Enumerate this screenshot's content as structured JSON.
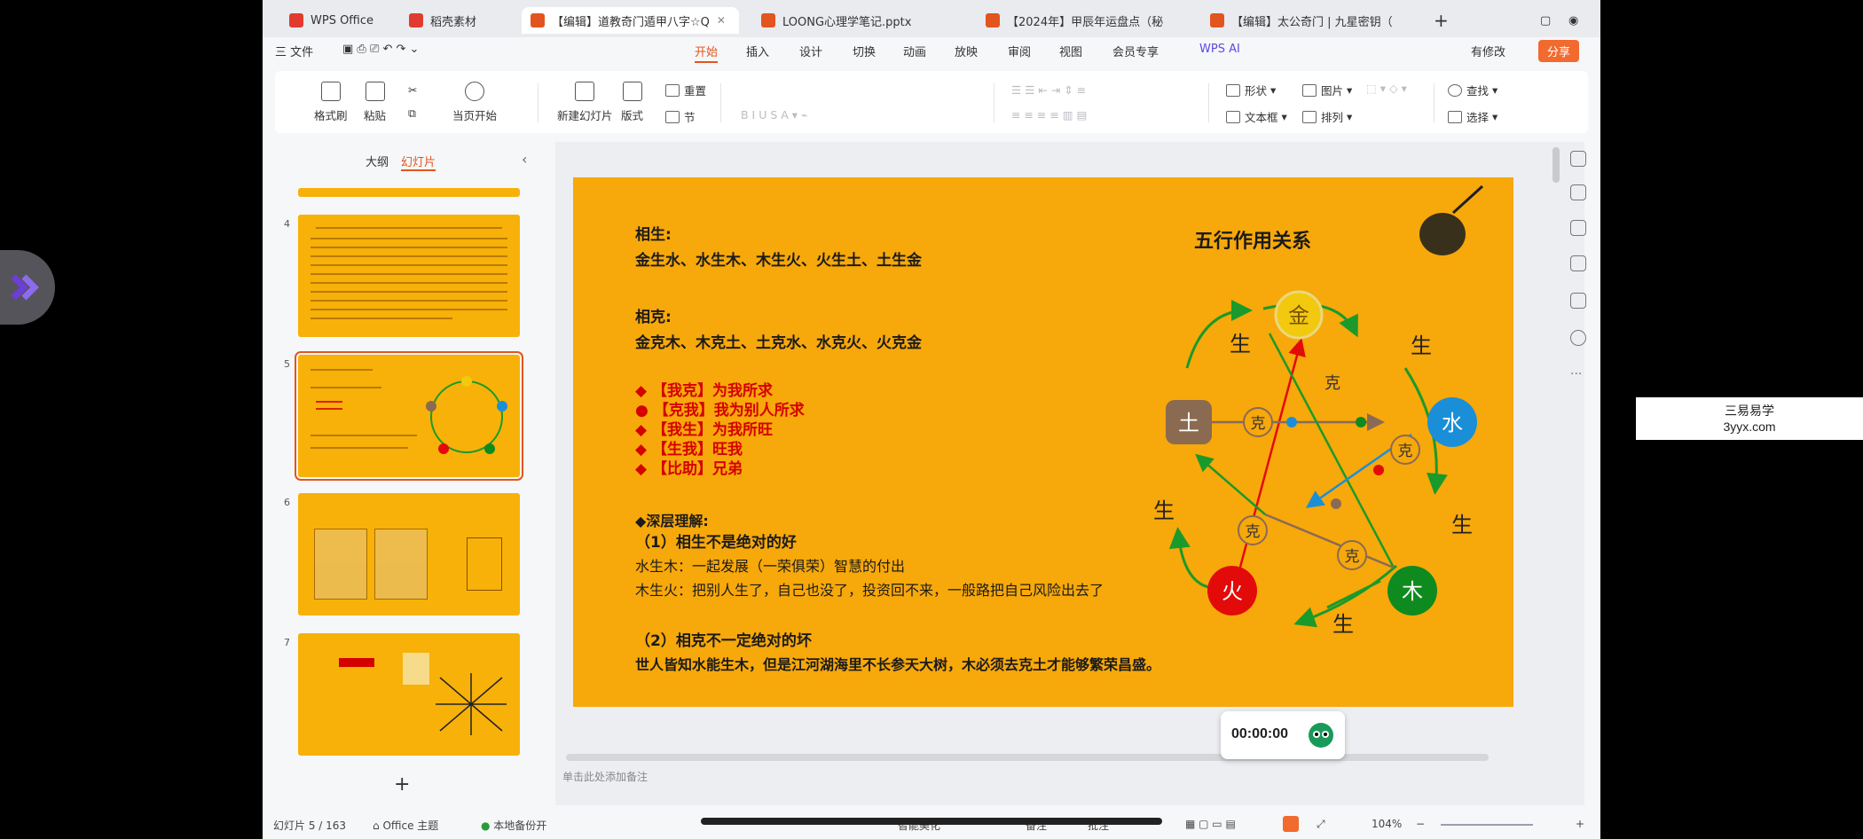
{
  "overlay": {
    "watermark_line1": "三易易学",
    "watermark_line2": "3yyx.com"
  },
  "tabs": [
    {
      "label": "WPS Office",
      "color": "#e03b2e"
    },
    {
      "label": "稻壳素材",
      "color": "#e03b2e"
    },
    {
      "label": "【编辑】道教奇门遁甲八字☆Q",
      "color": "#e2551e",
      "active": true
    },
    {
      "label": "LOONG心理学笔记.pptx",
      "color": "#e2551e"
    },
    {
      "label": "【2024年】甲辰年运盘点（秘",
      "color": "#e2551e"
    },
    {
      "label": "【编辑】太公奇门 | 九星密钥（",
      "color": "#e2551e"
    }
  ],
  "menu": {
    "file": "三 文件",
    "items": [
      "开始",
      "插入",
      "设计",
      "切换",
      "动画",
      "放映",
      "审阅",
      "视图",
      "会员专享"
    ],
    "ai": "WPS AI",
    "modify": "有修改",
    "share": "分享"
  },
  "ribbon": {
    "format_painter": "格式刷",
    "paste": "粘贴",
    "from_current": "当页开始",
    "new_slide": "新建幻灯片",
    "layout": "版式",
    "reset": "重置",
    "section": "节",
    "shape": "形状",
    "picture": "图片",
    "find": "查找",
    "textbox": "文本框",
    "arrange": "排列",
    "select": "选择"
  },
  "panel": {
    "tab_outline": "大纲",
    "tab_slides": "幻灯片",
    "slide_numbers": [
      "4",
      "5",
      "6",
      "7"
    ],
    "add": "+"
  },
  "slide": {
    "title": "五行作用关系",
    "sheng_label": "相生:",
    "sheng_text": "金生水、水生木、木生火、火生土、土生金",
    "ke_label": "相克:",
    "ke_text": "金克木、木克土、土克水、水克火、火克金",
    "relations": [
      {
        "tag": "【我克】",
        "text": "为我所求"
      },
      {
        "tag": "【克我】",
        "text": "我为别人所求"
      },
      {
        "tag": "【我生】",
        "text": "为我所旺"
      },
      {
        "tag": "【生我】",
        "text": "旺我"
      },
      {
        "tag": "【比助】",
        "text": "兄弟"
      }
    ],
    "deep_title": "深层理解:",
    "p1_title": "（1）相生不是绝对的好",
    "p1_line1": "水生木：一起发展（一荣俱荣）智慧的付出",
    "p1_line2": "木生火：把别人生了，自己也没了，投资回不来，一般路把自己风险出去了",
    "p2_title": "（2）相克不一定绝对的坏",
    "p2_line1": "世人皆知水能生木，但是江河湖海里不长参天大树，木必须去克土才能够繁荣昌盛。",
    "elements": {
      "metal": "金",
      "water": "水",
      "wood": "木",
      "fire": "火",
      "earth": "土"
    },
    "sheng": "生",
    "ke": "克",
    "colors": {
      "background": "#f7a80a",
      "metal": "#f2c90f",
      "water": "#1a8fd8",
      "wood": "#0f8a1f",
      "fire": "#e30a0a",
      "earth": "#8a6a50",
      "arrow": "#1a9a2a"
    }
  },
  "notes_placeholder": "单击此处添加备注",
  "timer": "00:00:00",
  "status": {
    "slide_info": "幻灯片 5 / 163",
    "theme": "Office 主题",
    "backup": "本地备份开",
    "beautify": "智能美化",
    "notes": "备注",
    "comments": "批注",
    "zoom": "104%"
  }
}
